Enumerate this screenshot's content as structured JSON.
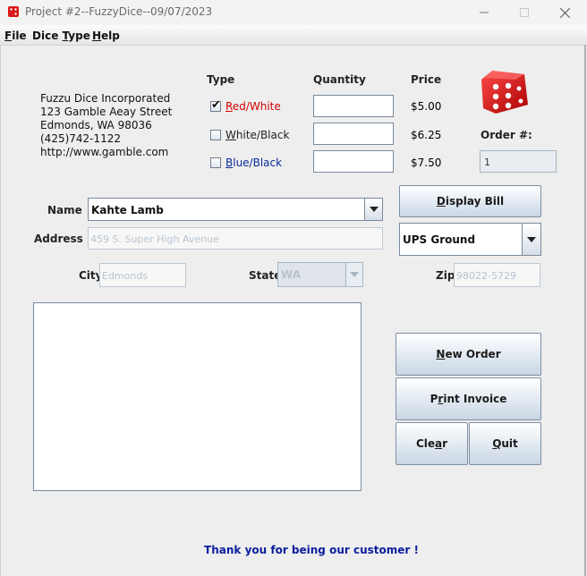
{
  "window": {
    "title": "Project #2--FuzzyDice--09/07/2023",
    "icons": {
      "app": "dice-icon",
      "minimize": "minimize-icon",
      "maximize": "maximize-icon",
      "close": "close-icon"
    }
  },
  "menu": [
    {
      "label": "File"
    },
    {
      "label": "Dice Type"
    },
    {
      "label": "Help"
    }
  ],
  "company": {
    "name": "Fuzzu Dice Incorporated",
    "street": "123 Gamble Aeay Street",
    "city_line": "Edmonds, WA 98036",
    "phone": "(425)742-1122",
    "web": "http://www.gamble.com"
  },
  "columns": {
    "type": "Type",
    "quantity": "Quantity",
    "price": "Price"
  },
  "dice_options": [
    {
      "label": "Red/White",
      "checked": true,
      "price": "$5.00",
      "quantity": "",
      "label_color": "#d40000"
    },
    {
      "label": "White/Black",
      "checked": false,
      "price": "$6.25",
      "quantity": "",
      "label_color": "#222222"
    },
    {
      "label": "Blue/Black",
      "checked": false,
      "price": "$7.50",
      "quantity": "",
      "label_color": "#0a2a9c"
    }
  ],
  "order": {
    "label": "Order #:",
    "value": "1"
  },
  "customer": {
    "name_label": "Name",
    "name_value": "Kahte Lamb",
    "address_label": "Address",
    "address_value": "459 S. Super High Avenue",
    "city_label": "City",
    "city_value": "Edmonds",
    "state_label": "State",
    "state_value": "WA",
    "zip_label": "Zip",
    "zip_value": "98022-5729"
  },
  "shipping": {
    "selected": "UPS Ground"
  },
  "buttons": {
    "display_bill": "Display Bill",
    "new_order": "New Order",
    "print_invoice": "Print Invoice",
    "clear": "Clear",
    "quit": "Quit"
  },
  "footer": "Thank you for being our customer !"
}
